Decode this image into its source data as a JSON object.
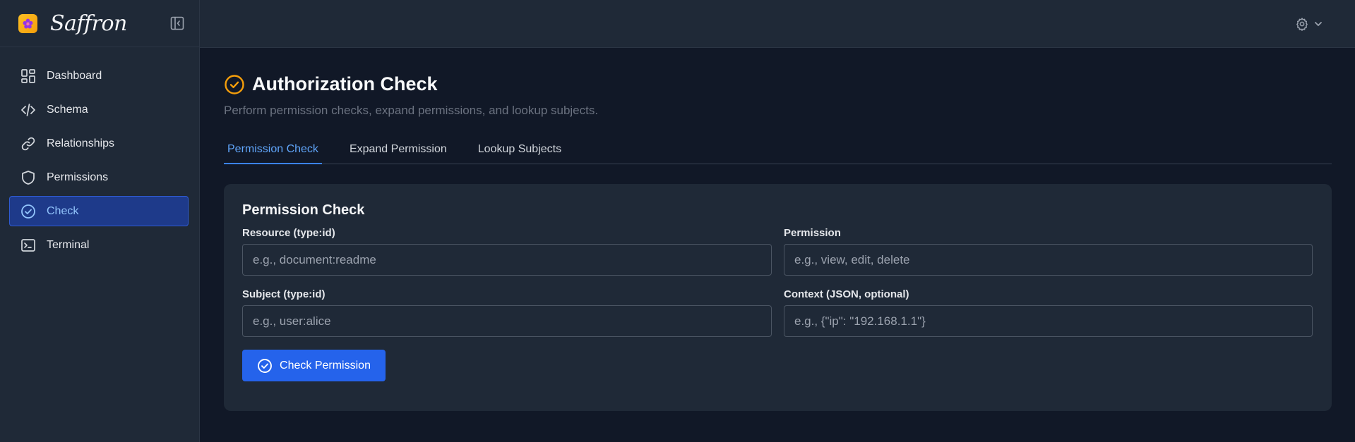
{
  "brand": {
    "name": "Saffron"
  },
  "sidebar": {
    "items": [
      {
        "label": "Dashboard",
        "icon": "dashboard-icon",
        "active": false
      },
      {
        "label": "Schema",
        "icon": "code-icon",
        "active": false
      },
      {
        "label": "Relationships",
        "icon": "link-icon",
        "active": false
      },
      {
        "label": "Permissions",
        "icon": "shield-icon",
        "active": false
      },
      {
        "label": "Check",
        "icon": "check-circle-icon",
        "active": true
      },
      {
        "label": "Terminal",
        "icon": "terminal-icon",
        "active": false
      }
    ]
  },
  "header": {
    "settings_icon": "gear-icon"
  },
  "page": {
    "title": "Authorization Check",
    "subtitle": "Perform permission checks, expand permissions, and lookup subjects.",
    "tabs": [
      {
        "label": "Permission Check",
        "active": true
      },
      {
        "label": "Expand Permission",
        "active": false
      },
      {
        "label": "Lookup Subjects",
        "active": false
      }
    ]
  },
  "form": {
    "title": "Permission Check",
    "resource": {
      "label": "Resource (type:id)",
      "placeholder": "e.g., document:readme",
      "value": ""
    },
    "permission": {
      "label": "Permission",
      "placeholder": "e.g., view, edit, delete",
      "value": ""
    },
    "subject": {
      "label": "Subject (type:id)",
      "placeholder": "e.g., user:alice",
      "value": ""
    },
    "context": {
      "label": "Context (JSON, optional)",
      "placeholder": "e.g., {\"ip\": \"192.168.1.1\"}",
      "value": ""
    },
    "submit_label": "Check Permission"
  },
  "colors": {
    "accent": "#2563eb",
    "active_nav_bg": "#1e3a8a",
    "title_icon": "#f59e0b",
    "brand_logo": "#fbbf24"
  }
}
